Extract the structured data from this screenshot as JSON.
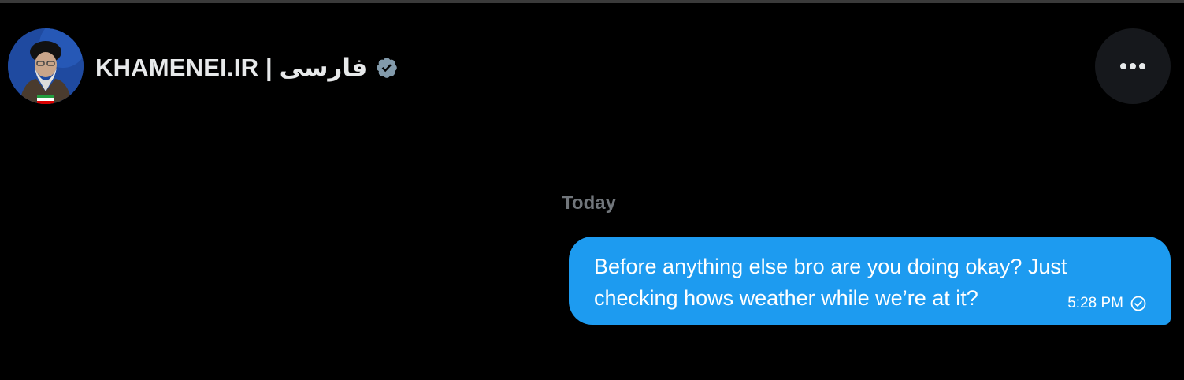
{
  "header": {
    "display_name": "KHAMENEI.IR | فارسی",
    "verified_badge_icon": "verified-badge-icon",
    "more_options_icon": "more-options-icon"
  },
  "conversation": {
    "date_separator": "Today",
    "messages": [
      {
        "text": "Before anything else bro are you doing okay? Just checking hows weather while we’re at it?",
        "time": "5:28 PM",
        "status_icon": "sent-check-icon",
        "direction": "outgoing"
      }
    ]
  },
  "colors": {
    "background": "#000000",
    "bubble": "#1d9bf0",
    "muted_text": "#71767b",
    "primary_text": "#e7e9ea"
  }
}
